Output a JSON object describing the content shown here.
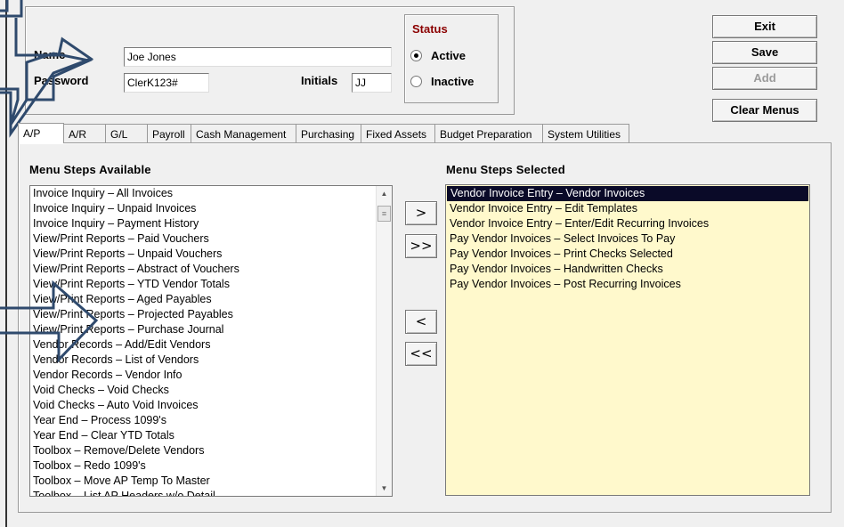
{
  "form": {
    "name_label": "Name",
    "name_value": "Joe Jones",
    "password_label": "Password",
    "password_value": "ClerK123#",
    "initials_label": "Initials",
    "initials_value": "JJ"
  },
  "status": {
    "title": "Status",
    "options": [
      {
        "label": "Active",
        "selected": true
      },
      {
        "label": "Inactive",
        "selected": false
      }
    ]
  },
  "buttons": {
    "exit": "Exit",
    "save": "Save",
    "add": "Add",
    "clear_menus": "Clear Menus"
  },
  "tabs": [
    "A/P",
    "A/R",
    "G/L",
    "Payroll",
    "Cash Management",
    "Purchasing",
    "Fixed Assets",
    "Budget Preparation",
    "System Utilities"
  ],
  "active_tab": "A/P",
  "available": {
    "title": "Menu Steps Available",
    "items": [
      "Invoice Inquiry – All Invoices",
      "Invoice Inquiry – Unpaid Invoices",
      "Invoice Inquiry – Payment History",
      "View/Print Reports – Paid Vouchers",
      "View/Print Reports – Unpaid Vouchers",
      "View/Print Reports – Abstract of Vouchers",
      "View/Print Reports – YTD Vendor Totals",
      "View/Print Reports – Aged Payables",
      "View/Print Reports – Projected Payables",
      "View/Print Reports – Purchase Journal",
      "Vendor Records – Add/Edit Vendors",
      "Vendor Records – List of Vendors",
      "Vendor Records – Vendor Info",
      "Void Checks – Void Checks",
      "Void Checks – Auto Void Invoices",
      "Year End – Process 1099's",
      "Year End – Clear YTD Totals",
      "Toolbox – Remove/Delete Vendors",
      "Toolbox – Redo 1099's",
      "Toolbox – Move AP Temp To Master",
      "Toolbox – List AP Headers w/o Detail"
    ]
  },
  "transfer": {
    "add_one": ">",
    "add_all": ">>",
    "remove_one": "<",
    "remove_all": "<<"
  },
  "selected": {
    "title": "Menu Steps Selected",
    "items": [
      "Vendor Invoice Entry – Vendor Invoices",
      "Vendor Invoice Entry – Edit Templates",
      "Vendor Invoice Entry – Enter/Edit Recurring Invoices",
      "Pay Vendor Invoices – Select Invoices To Pay",
      "Pay Vendor Invoices – Print Checks Selected",
      "Pay Vendor Invoices – Handwritten Checks",
      "Pay Vendor Invoices – Post Recurring Invoices"
    ],
    "highlighted_index": 0
  },
  "colors": {
    "status_title": "#8b0000",
    "selected_bg": "#fff9cc",
    "highlight_bg": "#0a0a28",
    "arrow": "#2f4a6d"
  }
}
